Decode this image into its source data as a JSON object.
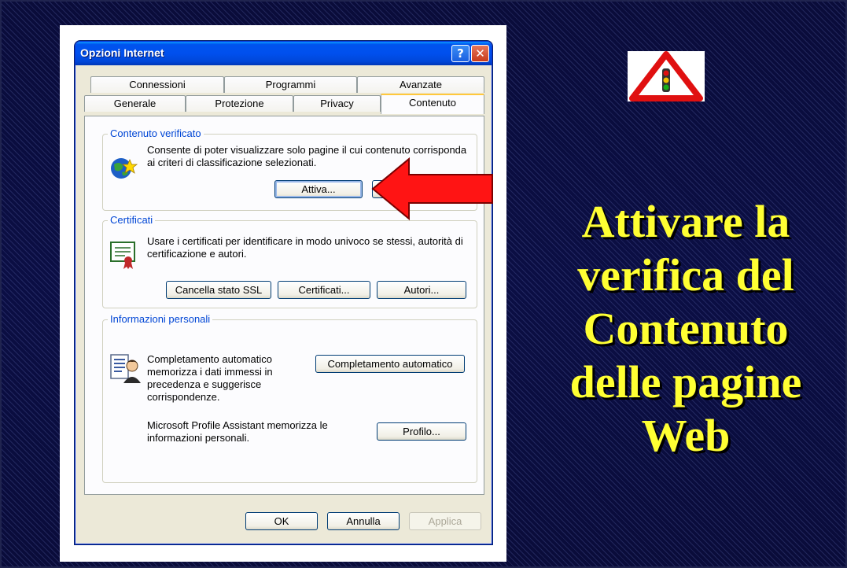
{
  "dialog": {
    "title": "Opzioni Internet",
    "help_glyph": "?",
    "close_glyph": "✕",
    "tabs_back": [
      "Connessioni",
      "Programmi",
      "Avanzate"
    ],
    "tabs_front": [
      "Generale",
      "Protezione",
      "Privacy",
      "Contenuto"
    ],
    "active_tab": "Contenuto",
    "content_advisor": {
      "title": "Contenuto verificato",
      "description": "Consente di poter visualizzare solo pagine il cui contenuto corrisponda ai criteri di classificazione selezionati.",
      "enable_button": "Attiva..."
    },
    "certificates": {
      "title": "Certificati",
      "description": "Usare i certificati per identificare in modo univoco se stessi, autorità di certificazione e autori.",
      "clear_ssl_button": "Cancella stato SSL",
      "certificates_button": "Certificati...",
      "publishers_button": "Autori..."
    },
    "personal_info": {
      "title": "Informazioni personali",
      "autocomplete_description": "Completamento automatico memorizza i dati immessi in precedenza e suggerisce corrispondenze.",
      "autocomplete_button": "Completamento automatico",
      "profile_description": "Microsoft Profile Assistant memorizza le informazioni personali.",
      "profile_button": "Profilo..."
    },
    "footer": {
      "ok_button": "OK",
      "cancel_button": "Annulla",
      "apply_button": "Applica"
    }
  },
  "headline": {
    "lines": [
      "Attivare la",
      "verifica del",
      "Contenuto",
      "delle pagine",
      "Web"
    ],
    "color": "#ffff33"
  },
  "colors": {
    "background": "#0b0e44",
    "titlebar": "#0053ee",
    "arrow": "#ff0000",
    "group_title": "#0046d5"
  },
  "icons": [
    "globe-star-icon",
    "certificate-icon",
    "person-card-icon",
    "warning-traffic-light-icon",
    "red-arrow-icon"
  ]
}
